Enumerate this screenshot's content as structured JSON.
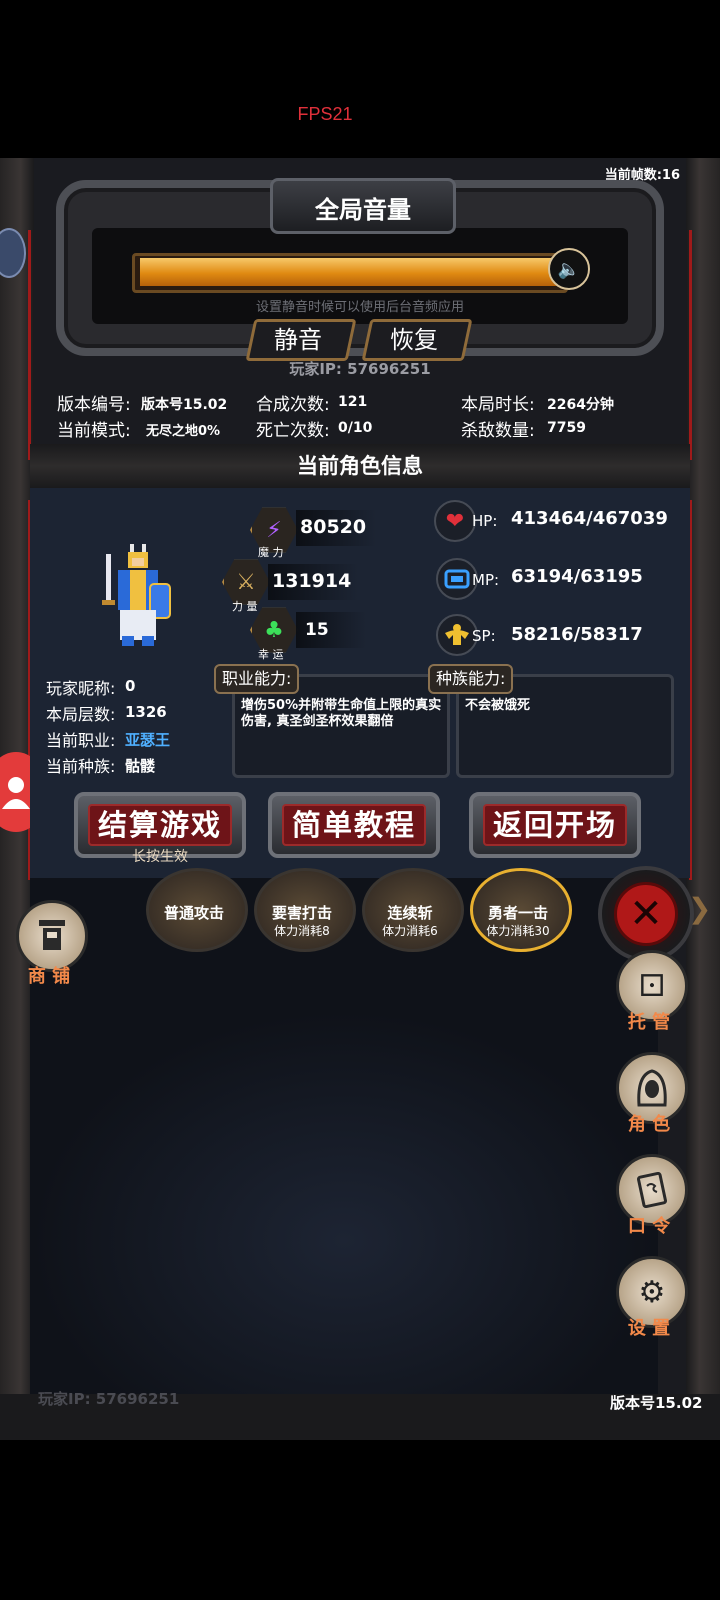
{
  "overlay": {
    "fps": "FPS21"
  },
  "header": {
    "frame_count": "当前帧数:16"
  },
  "volume": {
    "title": "全局音量",
    "level": 0.97,
    "hint": "设置静音时候可以使用后台音频应用",
    "mute_label": "静音",
    "restore_label": "恢复"
  },
  "player_ip": "玩家IP:  57696251",
  "stats": {
    "version_label": "版本编号:",
    "version_value": "版本号15.02",
    "mode_label": "当前模式:",
    "mode_value": "无尽之地0%",
    "synth_label": "合成次数:",
    "synth_value": "121",
    "death_label": "死亡次数:",
    "death_value": "0/10",
    "time_label": "本局时长:",
    "time_value": "2264分钟",
    "kills_label": "杀敌数量:",
    "kills_value": "7759"
  },
  "character": {
    "section_title": "当前角色信息",
    "magic_value": "80520",
    "magic_label": "魔 力",
    "power_value": "131914",
    "power_label": "力 量",
    "luck_value": "15",
    "luck_label": "幸 运",
    "hp_label": "HP:",
    "hp_value": "413464/467039",
    "mp_label": "MP:",
    "mp_value": "63194/63195",
    "sp_label": "SP:",
    "sp_value": "58216/58317",
    "nickname_label": "玩家昵称:",
    "nickname_value": "0",
    "floor_label": "本局层数:",
    "floor_value": "1326",
    "job_label": "当前职业:",
    "job_value": "亚瑟王",
    "race_label": "当前种族:",
    "race_value": "骷髅",
    "job_ability_title": "职业能力:",
    "job_ability_text": "增伤50%并附带生命值上限的真实伤害, 真圣剑圣杯效果翻倍",
    "race_ability_title": "种族能力:",
    "race_ability_text": "不会被饿死"
  },
  "actions": {
    "settle_label": "结算游戏",
    "settle_sub": "长按生效",
    "tutorial_label": "简单教程",
    "back_label": "返回开场"
  },
  "skills": [
    {
      "name": "普通攻击",
      "cost": ""
    },
    {
      "name": "要害打击",
      "cost": "体力消耗8"
    },
    {
      "name": "连续斩",
      "cost": "体力消耗6"
    },
    {
      "name": "勇者一击",
      "cost": "体力消耗30"
    }
  ],
  "side_menu": {
    "shop_label": "商 铺",
    "auto_label": "托 管",
    "role_label": "角 色",
    "command_label": "口 令",
    "settings_label": "设 置"
  },
  "footer": {
    "ip": "玩家IP:  57696251",
    "version": "版本号15.02"
  },
  "colors": {
    "accent_orange": "#f2894a",
    "job_blue": "#4fb0ff",
    "hp_red": "#e0303a"
  }
}
